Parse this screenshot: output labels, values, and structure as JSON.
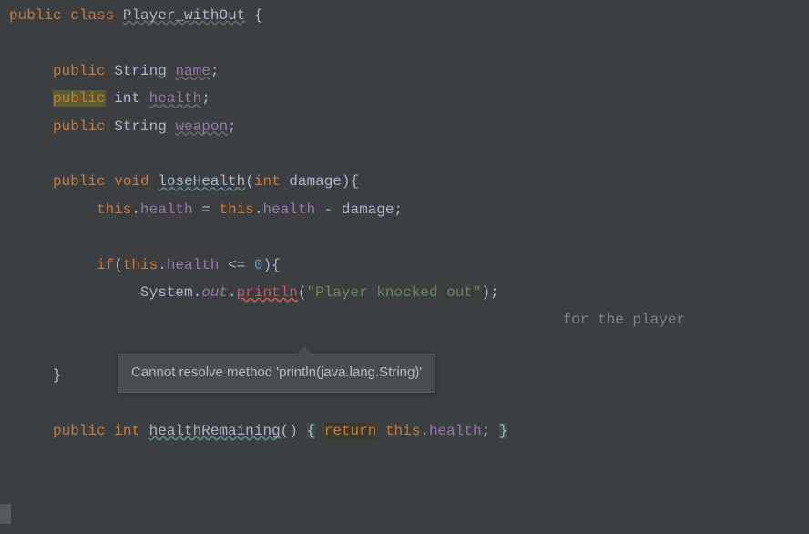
{
  "code": {
    "line1": {
      "kw1": "public",
      "kw2": "class",
      "name": "Player_withOut",
      "brace": "{"
    },
    "line2": {
      "kw": "public",
      "type": "String",
      "name": "name",
      "semi": ";"
    },
    "line3": {
      "kw": "public",
      "type": "int",
      "name": "health",
      "semi": ";"
    },
    "line4": {
      "kw": "public",
      "type": "String",
      "name": "weapon",
      "semi": ";"
    },
    "line5": {
      "kw": "public",
      "ret": "void",
      "name": "loseHealth",
      "lp": "(",
      "ptype": "int",
      "pname": "damage",
      "rp": ")",
      "brace": "{"
    },
    "line6": {
      "this1": "this",
      "dot1": ".",
      "f1": "health",
      "eq": " = ",
      "this2": "this",
      "dot2": ".",
      "f2": "health",
      "minus": " - ",
      "var": "damage",
      "semi": ";"
    },
    "line7": {
      "if": "if",
      "lp": "(",
      "this": "this",
      "dot": ".",
      "f": "health",
      "op": " <= ",
      "num": "0",
      "rp": ")",
      "brace": "{"
    },
    "line8": {
      "cls": "System",
      "dot1": ".",
      "out": "out",
      "dot2": ".",
      "method": "println",
      "lp": "(",
      "str": "\"Player knocked out\"",
      "rp": ")",
      "semi": ";"
    },
    "line9": {
      "tail": " for the player"
    },
    "line10": {
      "brace": "}"
    },
    "line11": {
      "kw": "public",
      "ret": "int",
      "name": "healthRemaining",
      "lp": "(",
      "rp": ")",
      "sp": " ",
      "lb": "{",
      "sp2": " ",
      "retkw": "return",
      "sp3": " ",
      "this": "this",
      "dot": ".",
      "f": "health",
      "semi": ";",
      "sp4": " ",
      "rb": "}"
    }
  },
  "tooltip": {
    "text": "Cannot resolve method 'println(java.lang.String)'"
  }
}
